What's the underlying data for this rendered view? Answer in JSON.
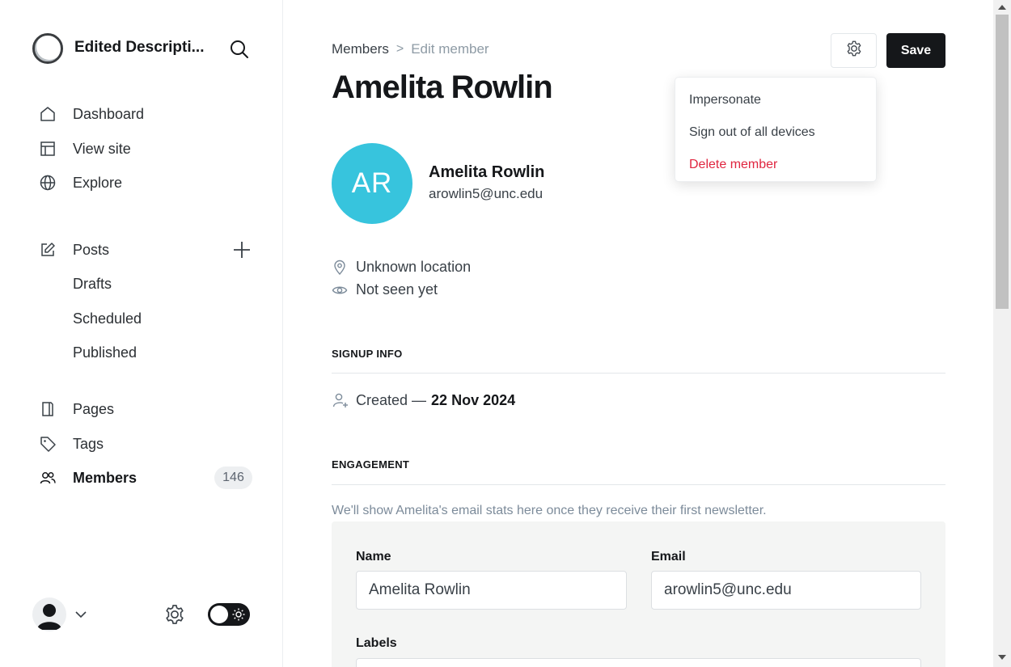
{
  "sidebar": {
    "site_title": "Edited Descripti...",
    "nav": [
      {
        "label": "Dashboard",
        "icon": "home-icon"
      },
      {
        "label": "View site",
        "icon": "layout-icon"
      },
      {
        "label": "Explore",
        "icon": "globe-icon"
      }
    ],
    "posts": {
      "label": "Posts",
      "icon": "edit-icon",
      "sub": [
        "Drafts",
        "Scheduled",
        "Published"
      ]
    },
    "pages_label": "Pages",
    "tags_label": "Tags",
    "members_label": "Members",
    "members_count": "146"
  },
  "header": {
    "breadcrumb_parent": "Members",
    "breadcrumb_sep": ">",
    "breadcrumb_current": "Edit member",
    "title": "Amelita Rowlin",
    "save_label": "Save"
  },
  "dropdown": {
    "items": [
      "Impersonate",
      "Sign out of all devices",
      "Delete member"
    ]
  },
  "member": {
    "initials": "AR",
    "name": "Amelita Rowlin",
    "email": "arowlin5@unc.edu",
    "avatar_color": "#37c4dd",
    "location": "Unknown location",
    "seen": "Not seen yet"
  },
  "signup": {
    "heading": "SIGNUP INFO",
    "created_prefix": "Created —",
    "created_date": "22 Nov 2024"
  },
  "engagement": {
    "heading": "ENGAGEMENT",
    "note": "We'll show Amelita's email stats here once they receive their first newsletter."
  },
  "form": {
    "name_label": "Name",
    "name_value": "Amelita Rowlin",
    "email_label": "Email",
    "email_value": "arowlin5@unc.edu",
    "labels_label": "Labels"
  },
  "colors": {
    "accent_dark": "#15171a",
    "danger": "#e0253f"
  }
}
